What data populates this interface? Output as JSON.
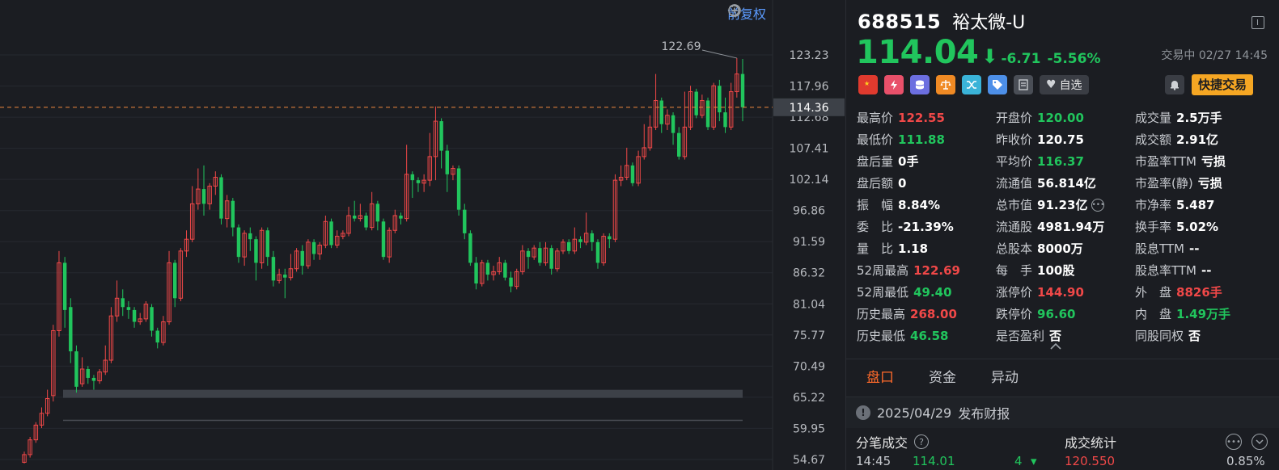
{
  "chart": {
    "restore_label": "前复权",
    "icons": [
      "undo-icon",
      "zoom-out-icon",
      "zoom-in-icon"
    ],
    "y_ticks": [
      "123.23",
      "117.96",
      "112.68",
      "107.41",
      "102.14",
      "96.86",
      "91.59",
      "86.32",
      "81.04",
      "75.77",
      "70.49",
      "65.22",
      "59.95",
      "54.67"
    ],
    "high_annotation": "122.69",
    "current_price_tag": "114.36",
    "colors": {
      "up": "#f04848",
      "down": "#21c55d",
      "bg": "#1b1d22",
      "grid": "#262930",
      "dash": "#f0883e"
    }
  },
  "chart_data": {
    "type": "candlestick",
    "title": "",
    "ylim": [
      54.67,
      125.5
    ],
    "current_price": 114.36,
    "high_label_value": 122.69,
    "bars": [
      [
        54.2,
        55.5,
        54.0,
        56.0
      ],
      [
        55.5,
        58.0,
        55.0,
        58.5
      ],
      [
        58.0,
        60.5,
        57.5,
        61.0
      ],
      [
        60.5,
        62.5,
        60.0,
        63.5
      ],
      [
        62.5,
        65.0,
        62.0,
        66.5
      ],
      [
        65.5,
        76.5,
        64.5,
        77.5
      ],
      [
        76.5,
        88.0,
        75.5,
        90.0
      ],
      [
        88.0,
        80.0,
        77.0,
        89.0
      ],
      [
        80.5,
        73.0,
        71.0,
        82.0
      ],
      [
        73.0,
        67.0,
        66.0,
        74.0
      ],
      [
        67.5,
        70.0,
        67.0,
        72.0
      ],
      [
        70.0,
        68.5,
        67.5,
        70.5
      ],
      [
        68.5,
        68.0,
        66.5,
        69.0
      ],
      [
        68.0,
        69.5,
        67.5,
        70.0
      ],
      [
        69.5,
        71.5,
        69.0,
        74.0
      ],
      [
        71.5,
        79.0,
        71.0,
        80.5
      ],
      [
        79.0,
        82.0,
        78.0,
        85.0
      ],
      [
        82.0,
        80.5,
        79.0,
        83.5
      ],
      [
        80.5,
        80.0,
        78.5,
        81.5
      ],
      [
        80.0,
        78.0,
        77.0,
        80.5
      ],
      [
        78.0,
        78.5,
        77.5,
        79.5
      ],
      [
        78.5,
        81.0,
        78.0,
        81.5
      ],
      [
        80.5,
        76.5,
        75.5,
        81.0
      ],
      [
        76.5,
        74.5,
        73.5,
        77.0
      ],
      [
        74.5,
        78.0,
        74.0,
        79.0
      ],
      [
        78.0,
        88.0,
        77.5,
        90.0
      ],
      [
        88.0,
        82.0,
        80.5,
        88.5
      ],
      [
        82.0,
        90.0,
        81.5,
        90.5
      ],
      [
        90.0,
        92.0,
        89.0,
        93.5
      ],
      [
        92.0,
        98.0,
        91.5,
        101.0
      ],
      [
        98.0,
        100.5,
        97.0,
        104.0
      ],
      [
        100.5,
        98.0,
        96.0,
        104.5
      ],
      [
        98.0,
        101.0,
        97.0,
        101.5
      ],
      [
        101.0,
        102.5,
        99.5,
        103.5
      ],
      [
        102.5,
        95.5,
        94.5,
        103.0
      ],
      [
        95.5,
        98.5,
        94.0,
        99.5
      ],
      [
        98.5,
        94.0,
        92.5,
        99.0
      ],
      [
        94.0,
        89.0,
        88.0,
        94.5
      ],
      [
        89.0,
        93.0,
        87.5,
        93.5
      ],
      [
        93.0,
        92.0,
        90.0,
        94.0
      ],
      [
        92.0,
        88.0,
        85.0,
        92.5
      ],
      [
        88.0,
        93.5,
        87.0,
        94.0
      ],
      [
        93.5,
        89.0,
        87.5,
        94.0
      ],
      [
        89.0,
        85.0,
        84.0,
        90.0
      ],
      [
        85.0,
        86.0,
        84.5,
        87.0
      ],
      [
        86.0,
        85.5,
        82.0,
        87.0
      ],
      [
        85.5,
        87.0,
        85.0,
        89.5
      ],
      [
        87.0,
        90.0,
        86.5,
        90.5
      ],
      [
        90.0,
        87.5,
        86.0,
        91.0
      ],
      [
        87.5,
        91.5,
        87.0,
        92.0
      ],
      [
        91.5,
        89.5,
        88.5,
        92.0
      ],
      [
        89.5,
        91.0,
        88.5,
        91.5
      ],
      [
        91.0,
        95.0,
        90.5,
        96.0
      ],
      [
        95.0,
        91.0,
        90.5,
        95.5
      ],
      [
        91.0,
        92.5,
        90.5,
        93.5
      ],
      [
        92.5,
        93.0,
        92.0,
        93.5
      ],
      [
        93.0,
        96.0,
        92.5,
        97.5
      ],
      [
        96.0,
        95.5,
        95.0,
        98.5
      ],
      [
        95.5,
        96.0,
        95.0,
        98.0
      ],
      [
        96.0,
        94.0,
        93.5,
        96.5
      ],
      [
        94.0,
        98.0,
        93.5,
        100.0
      ],
      [
        98.0,
        95.0,
        93.5,
        98.5
      ],
      [
        95.0,
        89.0,
        88.5,
        95.5
      ],
      [
        89.0,
        93.5,
        88.0,
        94.0
      ],
      [
        93.5,
        96.0,
        93.0,
        97.0
      ],
      [
        96.0,
        95.5,
        94.5,
        96.5
      ],
      [
        95.5,
        103.0,
        95.0,
        108.0
      ],
      [
        103.0,
        102.0,
        99.0,
        103.5
      ],
      [
        102.0,
        101.5,
        100.0,
        102.5
      ],
      [
        101.5,
        102.0,
        100.0,
        103.0
      ],
      [
        102.0,
        106.0,
        101.0,
        110.0
      ],
      [
        106.0,
        112.0,
        102.0,
        114.5
      ],
      [
        112.0,
        107.0,
        104.0,
        112.5
      ],
      [
        107.0,
        103.0,
        100.0,
        108.0
      ],
      [
        103.0,
        104.0,
        102.0,
        104.5
      ],
      [
        104.0,
        97.0,
        96.0,
        104.5
      ],
      [
        97.0,
        93.0,
        92.0,
        98.0
      ],
      [
        93.0,
        88.0,
        87.5,
        93.5
      ],
      [
        88.0,
        84.5,
        83.5,
        89.0
      ],
      [
        84.5,
        88.0,
        84.0,
        88.5
      ],
      [
        88.0,
        86.0,
        85.0,
        88.5
      ],
      [
        86.0,
        86.5,
        85.0,
        87.5
      ],
      [
        86.5,
        88.0,
        86.0,
        89.0
      ],
      [
        88.0,
        85.5,
        85.0,
        88.5
      ],
      [
        85.5,
        84.0,
        83.0,
        86.5
      ],
      [
        84.0,
        86.5,
        83.5,
        87.0
      ],
      [
        86.5,
        90.0,
        86.0,
        91.0
      ],
      [
        90.0,
        89.0,
        87.0,
        90.5
      ],
      [
        89.0,
        90.5,
        88.5,
        91.0
      ],
      [
        90.5,
        88.0,
        87.5,
        91.5
      ],
      [
        88.0,
        90.5,
        87.5,
        91.5
      ],
      [
        90.5,
        87.0,
        86.0,
        91.0
      ],
      [
        87.0,
        90.0,
        86.5,
        90.5
      ],
      [
        90.0,
        91.5,
        89.5,
        92.0
      ],
      [
        91.5,
        90.0,
        89.5,
        92.0
      ],
      [
        90.0,
        92.0,
        89.5,
        94.0
      ],
      [
        92.0,
        91.5,
        90.5,
        92.5
      ],
      [
        91.5,
        93.0,
        91.0,
        96.5
      ],
      [
        93.0,
        91.5,
        90.0,
        93.5
      ],
      [
        91.5,
        88.0,
        87.0,
        92.0
      ],
      [
        88.0,
        92.5,
        87.5,
        93.0
      ],
      [
        92.5,
        92.0,
        90.5,
        93.0
      ],
      [
        92.0,
        102.0,
        91.5,
        103.0
      ],
      [
        102.0,
        102.5,
        101.0,
        104.5
      ],
      [
        102.5,
        104.5,
        102.0,
        107.5
      ],
      [
        104.5,
        101.5,
        101.0,
        105.0
      ],
      [
        101.5,
        106.0,
        101.0,
        107.0
      ],
      [
        106.0,
        107.5,
        105.5,
        111.5
      ],
      [
        107.5,
        111.0,
        107.0,
        113.0
      ],
      [
        111.0,
        115.5,
        110.5,
        120.0
      ],
      [
        115.5,
        111.5,
        110.0,
        116.0
      ],
      [
        111.5,
        113.0,
        110.5,
        114.0
      ],
      [
        113.0,
        110.0,
        108.0,
        113.5
      ],
      [
        110.0,
        106.0,
        105.5,
        111.0
      ],
      [
        106.0,
        111.0,
        105.5,
        117.0
      ],
      [
        111.0,
        117.0,
        110.5,
        118.0
      ],
      [
        117.0,
        113.0,
        112.5,
        117.5
      ],
      [
        113.0,
        115.5,
        112.5,
        116.5
      ],
      [
        115.5,
        111.0,
        110.5,
        116.0
      ],
      [
        111.0,
        118.0,
        110.5,
        118.5
      ],
      [
        118.0,
        113.5,
        112.0,
        119.0
      ],
      [
        113.5,
        111.0,
        110.0,
        116.0
      ],
      [
        111.0,
        117.0,
        110.5,
        118.5
      ],
      [
        117.0,
        120.0,
        116.0,
        122.69
      ],
      [
        120.0,
        114.36,
        112.0,
        122.55
      ]
    ],
    "support_zones": [
      {
        "value": 65.8
      },
      {
        "value": 61.3
      }
    ]
  },
  "stock": {
    "code": "688515",
    "name": "裕太微-U",
    "price": "114.04",
    "change": "-6.71",
    "change_pct": "-5.56%",
    "status": "交易中 02/27 14:45",
    "watch_label": "自选",
    "quick_trade_label": "快捷交易"
  },
  "stats": [
    [
      {
        "label": "最高价",
        "value": "122.55",
        "color": "up"
      },
      {
        "label": "开盘价",
        "value": "120.00",
        "color": "down"
      },
      {
        "label": "成交量",
        "value": "2.5万手",
        "color": "neutral"
      }
    ],
    [
      {
        "label": "最低价",
        "value": "111.88",
        "color": "down"
      },
      {
        "label": "昨收价",
        "value": "120.75",
        "color": "neutral"
      },
      {
        "label": "成交额",
        "value": "2.91亿",
        "color": "neutral"
      }
    ],
    [
      {
        "label": "盘后量",
        "value": "0手",
        "color": "neutral"
      },
      {
        "label": "平均价",
        "value": "116.37",
        "color": "down"
      },
      {
        "label": "市盈率TTM",
        "value": "亏损",
        "color": "neutral"
      }
    ],
    [
      {
        "label": "盘后额",
        "value": "0",
        "color": "neutral"
      },
      {
        "label": "流通值",
        "value": "56.814亿",
        "color": "neutral"
      },
      {
        "label": "市盈率(静)",
        "value": "亏损",
        "color": "neutral"
      }
    ],
    [
      {
        "label": "振　幅",
        "value": "8.84%",
        "color": "neutral"
      },
      {
        "label": "总市值",
        "value": "91.23亿",
        "color": "neutral"
      },
      {
        "label": "市净率",
        "value": "5.487",
        "color": "neutral"
      }
    ],
    [
      {
        "label": "委　比",
        "value": "-21.39%",
        "color": "neutral"
      },
      {
        "label": "流通股",
        "value": "4981.94万",
        "color": "neutral"
      },
      {
        "label": "换手率",
        "value": "5.02%",
        "color": "neutral"
      }
    ],
    [
      {
        "label": "量　比",
        "value": "1.18",
        "color": "neutral"
      },
      {
        "label": "总股本",
        "value": "8000万",
        "color": "neutral"
      },
      {
        "label": "股息TTM",
        "value": "--",
        "color": "neutral"
      }
    ],
    [
      {
        "label": "52周最高",
        "value": "122.69",
        "color": "up"
      },
      {
        "label": "每　手",
        "value": "100股",
        "color": "neutral"
      },
      {
        "label": "股息率TTM",
        "value": "--",
        "color": "neutral"
      }
    ],
    [
      {
        "label": "52周最低",
        "value": "49.40",
        "color": "down"
      },
      {
        "label": "涨停价",
        "value": "144.90",
        "color": "up"
      },
      {
        "label": "外　盘",
        "value": "8826手",
        "color": "up"
      }
    ],
    [
      {
        "label": "历史最高",
        "value": "268.00",
        "color": "up"
      },
      {
        "label": "跌停价",
        "value": "96.60",
        "color": "down"
      },
      {
        "label": "内　盘",
        "value": "1.49万手",
        "color": "down"
      }
    ],
    [
      {
        "label": "历史最低",
        "value": "46.58",
        "color": "down"
      },
      {
        "label": "是否盈利",
        "value": "否",
        "color": "neutral"
      },
      {
        "label": "同股同权",
        "value": "否",
        "color": "neutral"
      }
    ]
  ],
  "tabs": [
    {
      "label": "盘口",
      "active": true
    },
    {
      "label": "资金",
      "active": false
    },
    {
      "label": "异动",
      "active": false
    }
  ],
  "notice": {
    "date": "2025/04/29",
    "text": "发布财报"
  },
  "trade": {
    "left_title": "分笔成交",
    "mid_title": "成交统计",
    "partial_row": {
      "time": "14:45",
      "price": "114.01",
      "vol": "4",
      "pct_red": "120.550",
      "pct_right": "0.85%"
    }
  }
}
